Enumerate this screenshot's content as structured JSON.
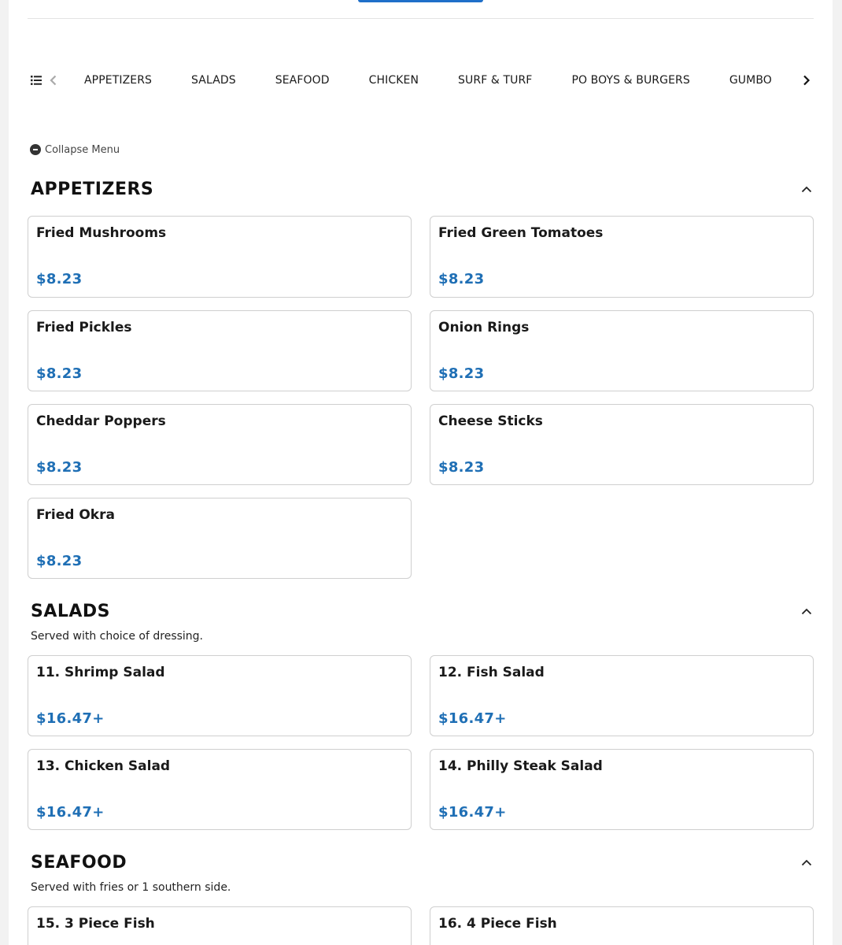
{
  "nav": {
    "categories": [
      "APPETIZERS",
      "SALADS",
      "SEAFOOD",
      "CHICKEN",
      "SURF & TURF",
      "PO BOYS & BURGERS",
      "GUMBO"
    ]
  },
  "collapse_label": "Collapse Menu",
  "sections": [
    {
      "title": "APPETIZERS",
      "description": "",
      "items": [
        {
          "name": "Fried Mushrooms",
          "price": "$8.23"
        },
        {
          "name": "Fried Green Tomatoes",
          "price": "$8.23"
        },
        {
          "name": "Fried Pickles",
          "price": "$8.23"
        },
        {
          "name": "Onion Rings",
          "price": "$8.23"
        },
        {
          "name": "Cheddar Poppers",
          "price": "$8.23"
        },
        {
          "name": "Cheese Sticks",
          "price": "$8.23"
        },
        {
          "name": "Fried Okra",
          "price": "$8.23"
        }
      ]
    },
    {
      "title": "SALADS",
      "description": "Served with choice of dressing.",
      "items": [
        {
          "name": "11. Shrimp Salad",
          "price": "$16.47+"
        },
        {
          "name": "12. Fish Salad",
          "price": "$16.47+"
        },
        {
          "name": "13. Chicken Salad",
          "price": "$16.47+"
        },
        {
          "name": "14. Philly Steak Salad",
          "price": "$16.47+"
        }
      ]
    },
    {
      "title": "SEAFOOD",
      "description": "Served with fries or 1 southern side.",
      "items": [
        {
          "name": "15. 3 Piece Fish",
          "price": ""
        },
        {
          "name": "16. 4 Piece Fish",
          "price": ""
        }
      ]
    }
  ],
  "colors": {
    "accent": "#1f6fb5",
    "button": "#1f6fc9",
    "card_border": "#cfcfcf"
  }
}
